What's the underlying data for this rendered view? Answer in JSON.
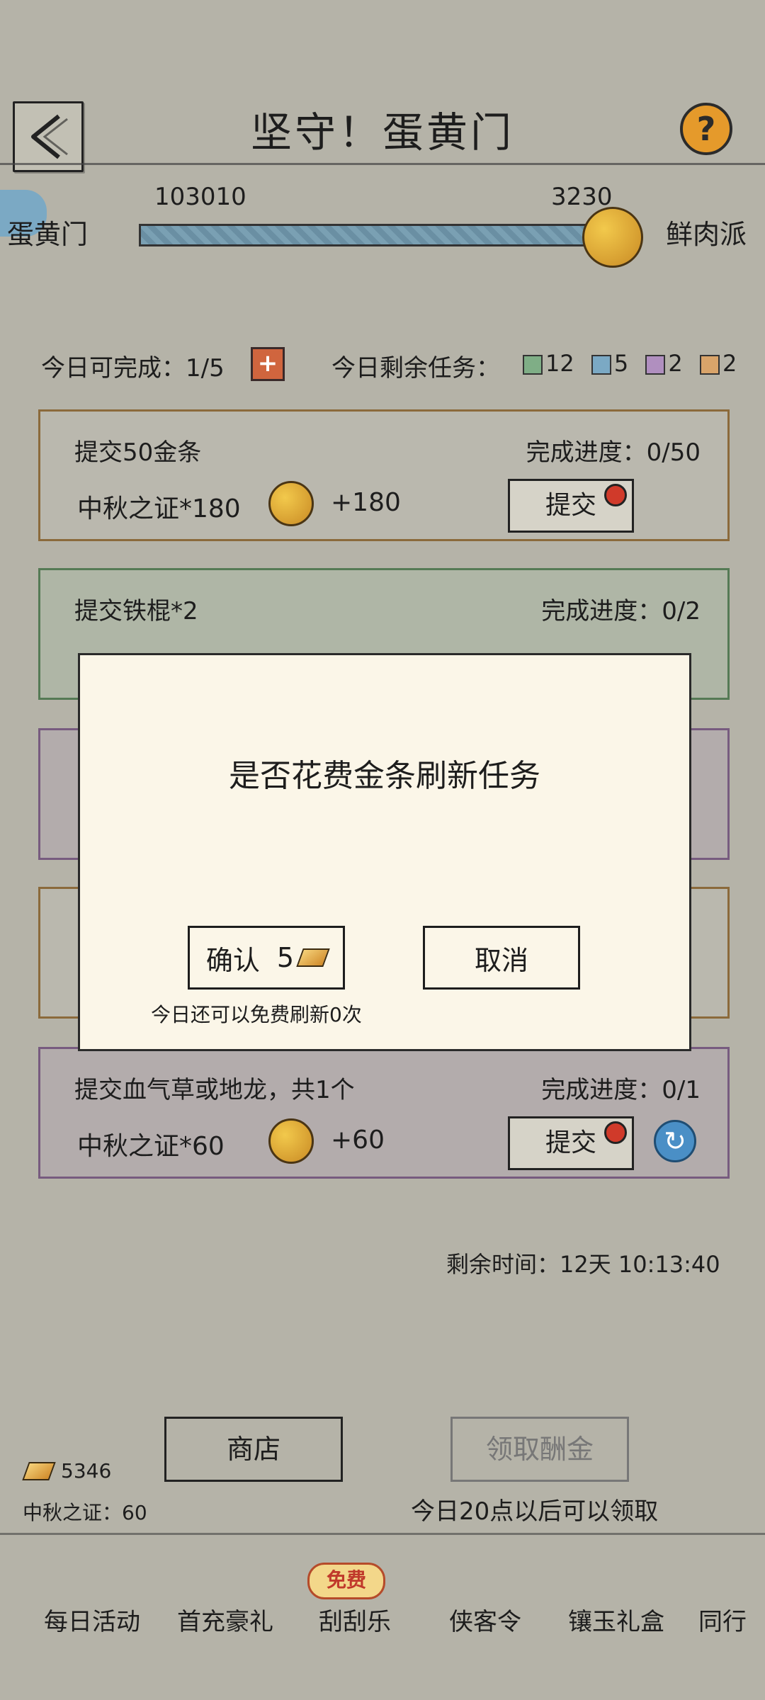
{
  "header": {
    "title": "坚守！蛋黄门"
  },
  "score": {
    "left_value": "103010",
    "right_value": "3230",
    "left_team": "蛋黄门",
    "right_team": "鲜肉派",
    "progress": 0.97
  },
  "daily": {
    "complete_label": "今日可完成：1/5",
    "remaining_label": "今日剩余任务：",
    "chips": [
      {
        "color": "#7fae86",
        "count": "12"
      },
      {
        "color": "#7ba9c4",
        "count": "5"
      },
      {
        "color": "#b08fbf",
        "count": "2"
      },
      {
        "color": "#d9a46a",
        "count": "2"
      }
    ]
  },
  "tasks": [
    {
      "title": "提交50金条",
      "reward": "中秋之证*180",
      "gain": "+180",
      "progress": "完成进度：0/50",
      "submit": "提交",
      "border": "#8b6a3b"
    },
    {
      "title": "提交铁棍*2",
      "reward": "",
      "gain": "",
      "progress": "完成进度：0/2",
      "submit": "",
      "border": "#557a55"
    },
    {
      "title": "",
      "reward": "",
      "gain": "",
      "progress": "",
      "submit": "",
      "border": "#775b7f"
    },
    {
      "title": "",
      "reward": "",
      "gain": "",
      "progress": "",
      "submit": "",
      "border": "#8b6a3b"
    },
    {
      "title": "提交血气草或地龙，共1个",
      "reward": "中秋之证*60",
      "gain": "+60",
      "progress": "完成进度：0/1",
      "submit": "提交",
      "border": "#775b7f"
    }
  ],
  "dialog": {
    "message": "是否花费金条刷新任务",
    "confirm": "确认",
    "cost": "5",
    "cancel": "取消",
    "note": "今日还可以免费刷新0次"
  },
  "remaining_time": "剩余时间：12天 10:13:40",
  "bottom": {
    "gold": "5346",
    "token_label": "中秋之证：60",
    "shop": "商店",
    "claim": "领取酬金",
    "claim_note": "今日20点以后可以领取"
  },
  "nav": {
    "badge": "免费",
    "items": [
      "每日活动",
      "首充豪礼",
      "刮刮乐",
      "侠客令",
      "镶玉礼盒",
      "同行"
    ]
  }
}
